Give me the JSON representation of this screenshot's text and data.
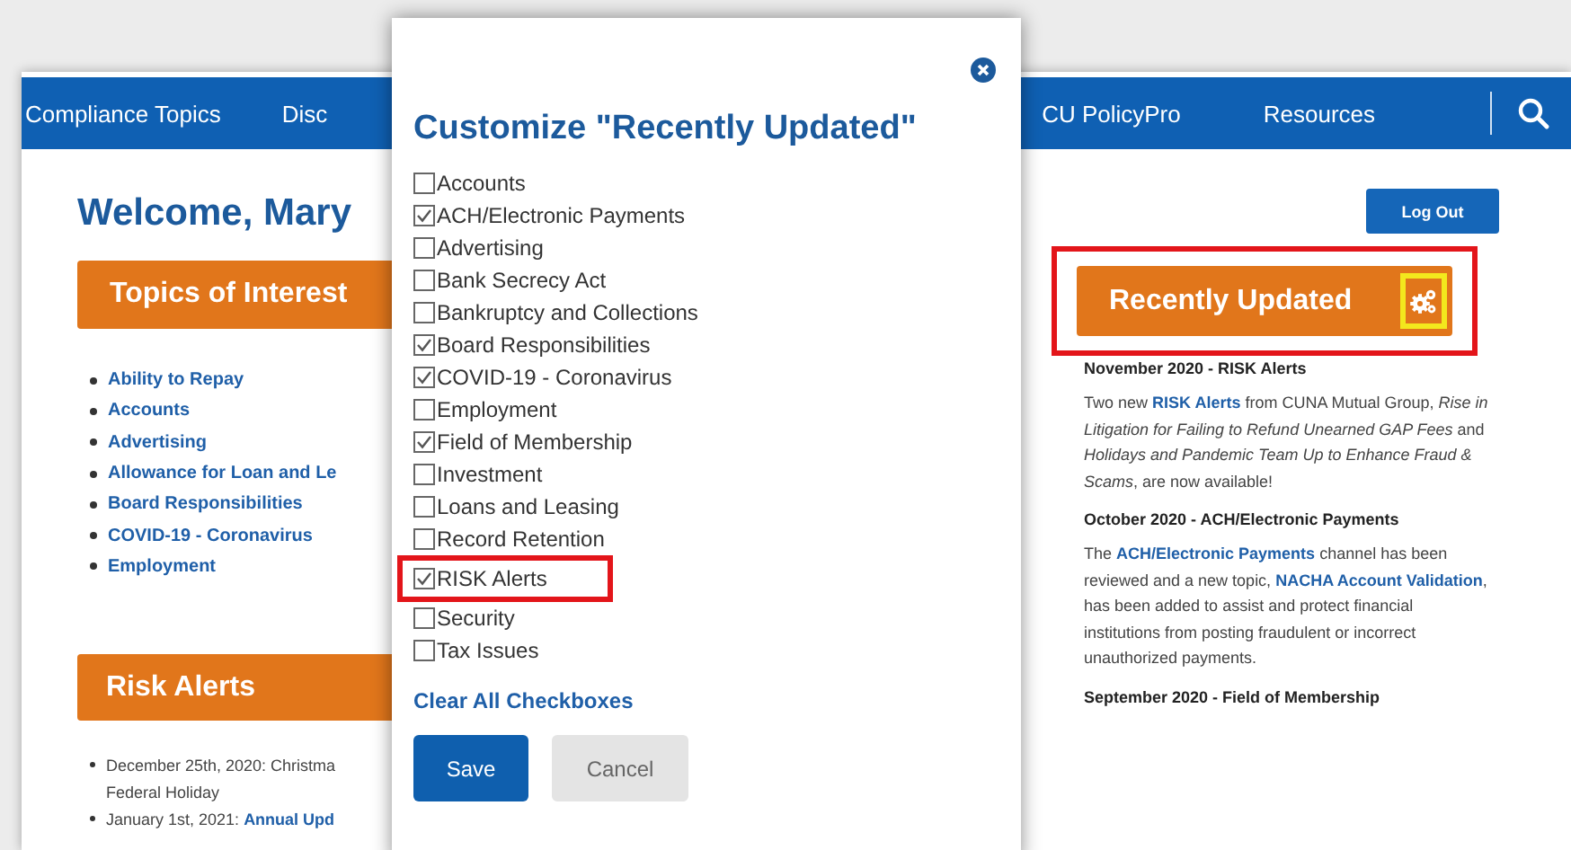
{
  "nav": {
    "items": [
      {
        "label": "Compliance Topics"
      },
      {
        "label": "Disc"
      },
      {
        "label": "CU PolicyPro"
      },
      {
        "label": "Resources"
      }
    ]
  },
  "welcome": "Welcome, Mary",
  "topics_of_interest": {
    "title": "Topics of Interest",
    "items": [
      {
        "label": "Ability to Repay"
      },
      {
        "label": "Accounts"
      },
      {
        "label": "Advertising"
      },
      {
        "label": "Allowance for Loan and Le"
      },
      {
        "label": "Board Responsibilities"
      },
      {
        "label": "COVID-19 - Coronavirus"
      },
      {
        "label": "Employment"
      }
    ]
  },
  "risk_alerts": {
    "title": "Risk Alerts",
    "items": [
      {
        "text": "December 25th, 2020: Christma",
        "continuation": "Federal Holiday"
      },
      {
        "text": "January 1st, 2021: ",
        "link": "Annual Upd"
      }
    ]
  },
  "logout_button": "Log Out",
  "recently_updated": {
    "title": "Recently Updated",
    "highlighted": true,
    "entries": [
      {
        "heading": "November 2020 - RISK Alerts",
        "segments": [
          {
            "kind": "plain",
            "text": "Two new "
          },
          {
            "kind": "link",
            "text": "RISK Alerts"
          },
          {
            "kind": "plain",
            "text": " from CUNA Mutual Group, "
          },
          {
            "kind": "italic",
            "text": "Rise in Litigation for Failing to Refund Unearned GAP Fees"
          },
          {
            "kind": "plain",
            "text": " and "
          },
          {
            "kind": "italic",
            "text": "Holidays and Pandemic Team Up to Enhance Fraud & Scams"
          },
          {
            "kind": "plain",
            "text": ", are now available!"
          }
        ]
      },
      {
        "heading": "October 2020 - ACH/Electronic Payments",
        "segments": [
          {
            "kind": "plain",
            "text": "The "
          },
          {
            "kind": "link",
            "text": "ACH/Electronic Payments"
          },
          {
            "kind": "plain",
            "text": " channel has been reviewed and a new topic, "
          },
          {
            "kind": "link",
            "text": "NACHA Account Validation"
          },
          {
            "kind": "plain",
            "text": ", has been added to assist and protect financial institutions from posting fraudulent or incorrect unauthorized payments."
          }
        ]
      },
      {
        "heading": "September 2020 - Field of Membership"
      }
    ]
  },
  "dialog": {
    "title": "Customize \"Recently Updated\"",
    "options": [
      {
        "label": "Accounts",
        "checked": false,
        "highlighted": false
      },
      {
        "label": "ACH/Electronic Payments",
        "checked": true,
        "highlighted": false
      },
      {
        "label": "Advertising",
        "checked": false,
        "highlighted": false
      },
      {
        "label": "Bank Secrecy Act",
        "checked": false,
        "highlighted": false
      },
      {
        "label": "Bankruptcy and Collections",
        "checked": false,
        "highlighted": false
      },
      {
        "label": "Board Responsibilities",
        "checked": true,
        "highlighted": false
      },
      {
        "label": "COVID-19 - Coronavirus",
        "checked": true,
        "highlighted": false
      },
      {
        "label": "Employment",
        "checked": false,
        "highlighted": false
      },
      {
        "label": "Field of Membership",
        "checked": true,
        "highlighted": false
      },
      {
        "label": "Investment",
        "checked": false,
        "highlighted": false
      },
      {
        "label": "Loans and Leasing",
        "checked": false,
        "highlighted": false
      },
      {
        "label": "Record Retention",
        "checked": false,
        "highlighted": false
      },
      {
        "label": "RISK Alerts",
        "checked": true,
        "highlighted": true
      },
      {
        "label": "Security",
        "checked": false,
        "highlighted": false
      },
      {
        "label": "Tax Issues",
        "checked": false,
        "highlighted": false
      }
    ],
    "clear_link": "Clear All Checkboxes",
    "buttons": [
      {
        "label": "Save",
        "kind": "primary"
      },
      {
        "label": "Cancel",
        "kind": "secondary"
      }
    ]
  }
}
